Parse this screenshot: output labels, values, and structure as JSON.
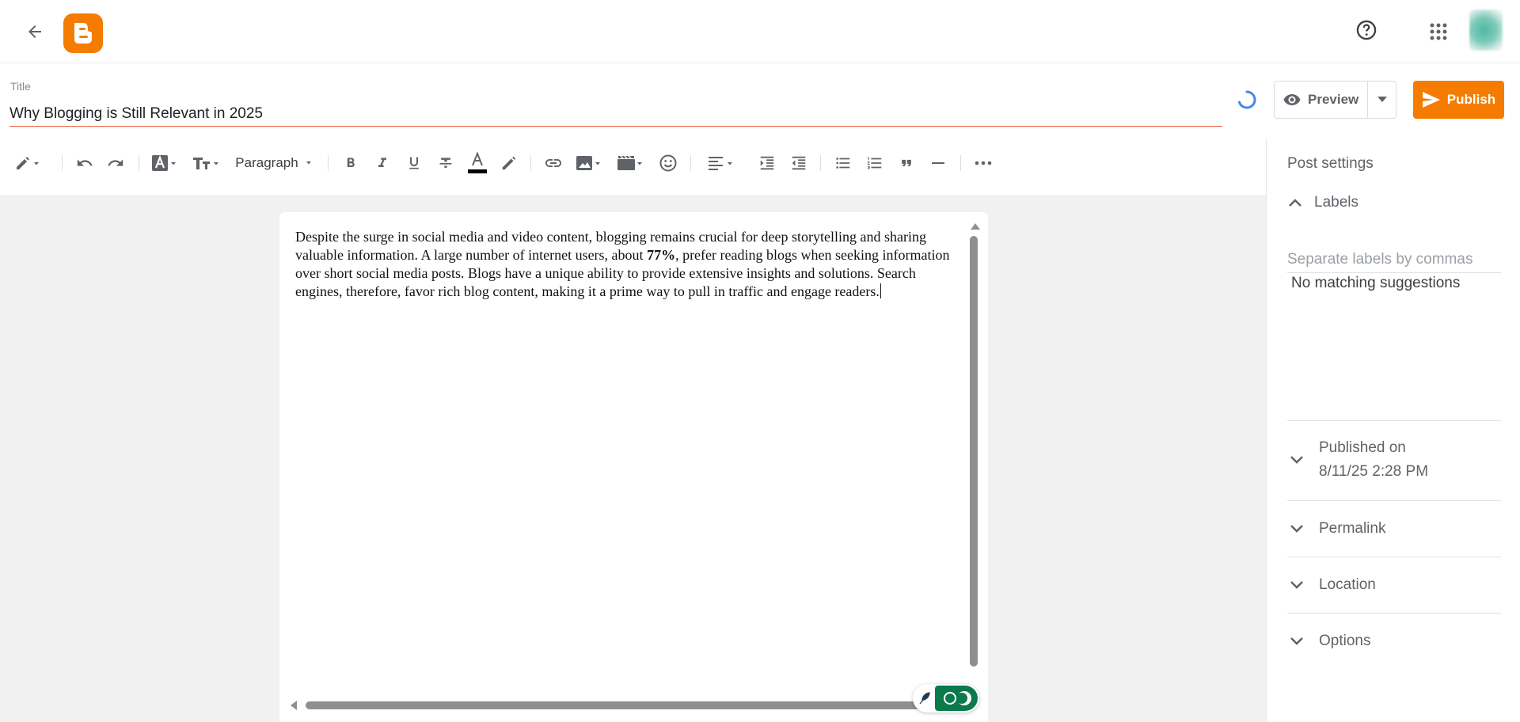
{
  "header": {
    "back_icon": "arrow-back-icon",
    "logo_icon": "blogger-logo-icon",
    "help_icon": "help-circle-icon",
    "apps_icon": "apps-grid-icon",
    "accent_color": "#f57c00"
  },
  "post": {
    "title_label": "Title",
    "title_value": "Why Blogging is Still Relevant in 2025",
    "body_before_bold": " Despite the surge in social media and video content, blogging remains crucial for deep storytelling and sharing valuable information. A large number of internet users, about ",
    "body_bold": "77%",
    "body_after_bold": ", prefer reading blogs when seeking information over short social media posts. Blogs have a unique ability to provide extensive insights and solutions. Search engines, therefore, favor rich blog content, making it a prime way to pull in traffic and engage readers."
  },
  "actions": {
    "preview_label": "Preview",
    "publish_label": "Publish"
  },
  "toolbar": {
    "paragraph_label": "Paragraph"
  },
  "sidebar": {
    "title": "Post settings",
    "labels_heading": "Labels",
    "labels_placeholder": "Separate labels by commas",
    "no_suggestions": "No matching suggestions",
    "published_on_label": "Published on",
    "published_on_value": "8/11/25 2:28 PM",
    "permalink_label": "Permalink",
    "location_label": "Location",
    "options_label": "Options"
  }
}
